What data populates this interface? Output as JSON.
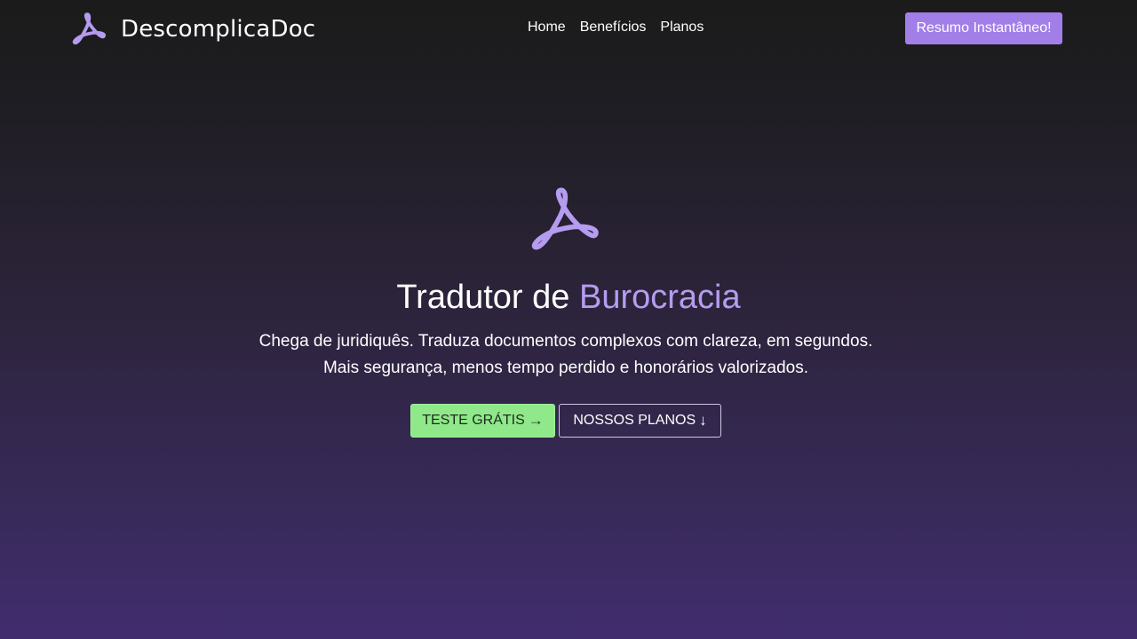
{
  "header": {
    "brand_name": "DescomplicaDoc",
    "logo_icon": "acrobat-pdf-icon",
    "nav": [
      {
        "label": "Home"
      },
      {
        "label": "Benefícios"
      },
      {
        "label": "Planos"
      }
    ],
    "cta_label": "Resumo Instantâneo!"
  },
  "hero": {
    "icon": "acrobat-pdf-icon",
    "title_main": "Tradutor de",
    "title_accent": "Burocracia",
    "subtitle_line1": "Chega de juridiquês. Traduza documentos complexos com clareza, em segundos.",
    "subtitle_line2": "Mais segurança, menos tempo perdido e honorários valorizados.",
    "primary_button": {
      "label": "TESTE GRÁTIS",
      "icon": "arrow-right-icon"
    },
    "secondary_button": {
      "label": "NOSSOS PLANOS",
      "icon": "arrow-down-icon"
    }
  },
  "colors": {
    "accent": "#a27ee8",
    "accent_text": "#b69cf0",
    "primary_button": "#8fe88a"
  }
}
